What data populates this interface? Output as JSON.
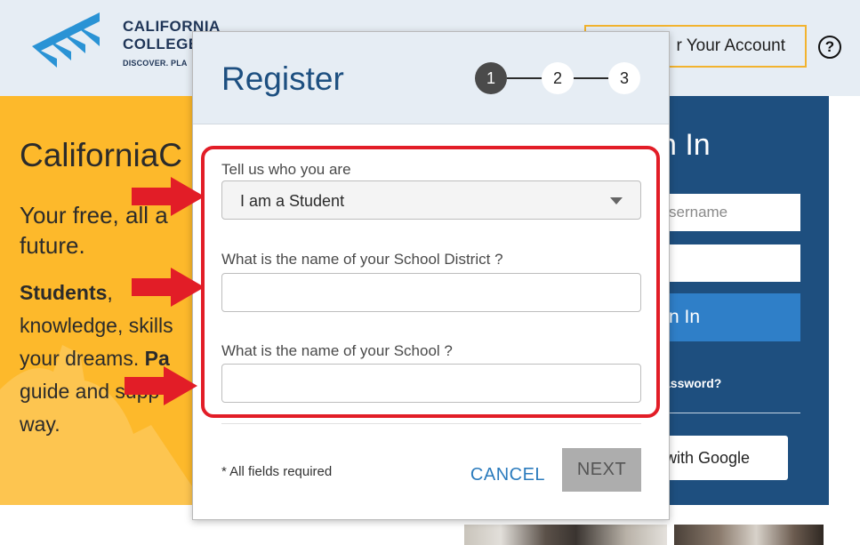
{
  "header": {
    "logo_line1": "CALIFORNIA",
    "logo_line2": "COLLEGE",
    "logo_tagline": "DISCOVER. PLA",
    "create_account_label": "r Your Account",
    "help_symbol": "?"
  },
  "hero": {
    "title": "CaliforniaC",
    "tagline": "Your free, all a future.",
    "body_bold1": "Students",
    "body_text1": ", knowledge, skills your dreams. ",
    "body_bold2": "Pa",
    "body_text2": " guide and supp way."
  },
  "signin": {
    "title": "n In",
    "username_placeholder": "sername",
    "button_label": "n In",
    "forgot_label": "assword?",
    "google_label": "with Google"
  },
  "modal": {
    "title": "Register",
    "steps": [
      "1",
      "2",
      "3"
    ],
    "current_step": 1,
    "fields": {
      "role_label": "Tell us who you are",
      "role_value": "I am a Student",
      "district_label": "What is the name of your School District ?",
      "district_value": "",
      "school_label": "What is the name of your School ?",
      "school_value": ""
    },
    "required_note": "* All fields required",
    "cancel_label": "CANCEL",
    "next_label": "NEXT"
  },
  "colors": {
    "brand_blue": "#1d4f80",
    "hero_yellow": "#fdb92b",
    "signin_panel": "#1e4f7f",
    "annotation_red": "#e21d27",
    "link_blue": "#2b7bbd",
    "next_disabled": "#adadad"
  },
  "icons": [
    "logo-chevrons-icon",
    "help-icon",
    "dropdown-caret-icon",
    "annotation-arrow-icon"
  ]
}
